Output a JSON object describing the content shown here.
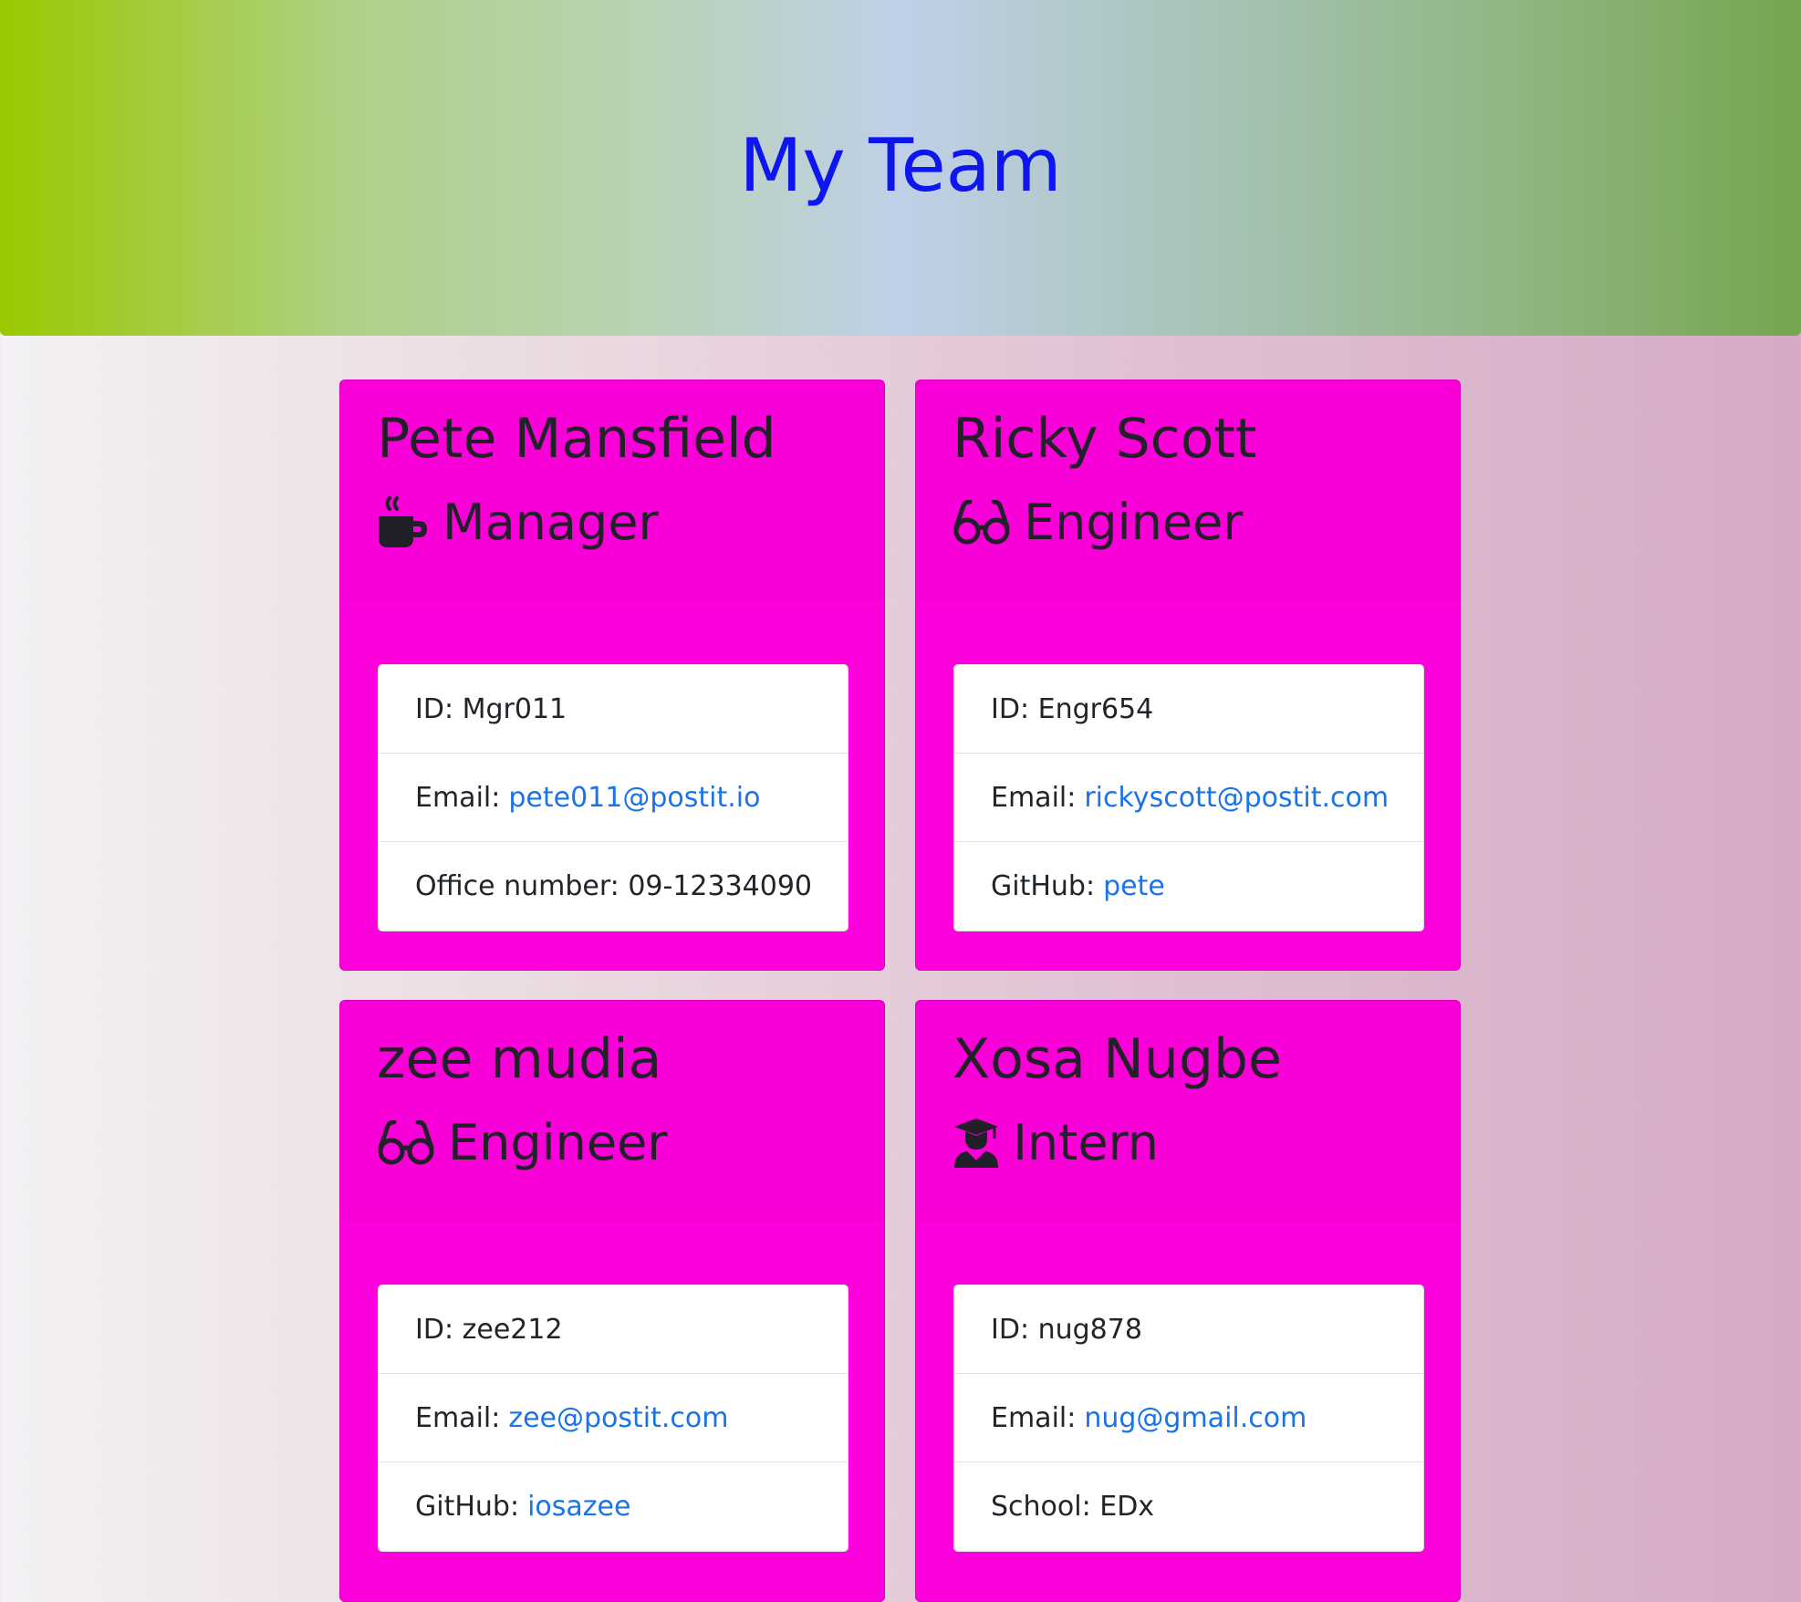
{
  "header": {
    "title": "My Team"
  },
  "employees": [
    {
      "name": "Pete Mansfield",
      "role": "Manager",
      "icon": "coffee-mug-icon",
      "id_label": "ID:",
      "id": "Mgr011",
      "email_label": "Email:",
      "email": "pete011@postit.io",
      "extra_label": "Office number:",
      "extra": "09-12334090"
    },
    {
      "name": "Ricky Scott",
      "role": "Engineer",
      "icon": "glasses-icon",
      "id_label": "ID:",
      "id": "Engr654",
      "email_label": "Email:",
      "email": "rickyscott@postit.com",
      "extra_label": "GitHub:",
      "extra": "pete"
    },
    {
      "name": "zee mudia",
      "role": "Engineer",
      "icon": "glasses-icon",
      "id_label": "ID:",
      "id": "zee212",
      "email_label": "Email:",
      "email": "zee@postit.com",
      "extra_label": "GitHub:",
      "extra": "iosazee"
    },
    {
      "name": "Xosa Nugbe",
      "role": "Intern",
      "icon": "graduate-icon",
      "id_label": "ID:",
      "id": "nug878",
      "email_label": "Email:",
      "email": "nug@gmail.com",
      "extra_label": "School:",
      "extra": "EDx"
    }
  ],
  "colors": {
    "card_background": "#fe00dc",
    "title_color": "#0d16ee",
    "link_color": "#1a73e8"
  }
}
